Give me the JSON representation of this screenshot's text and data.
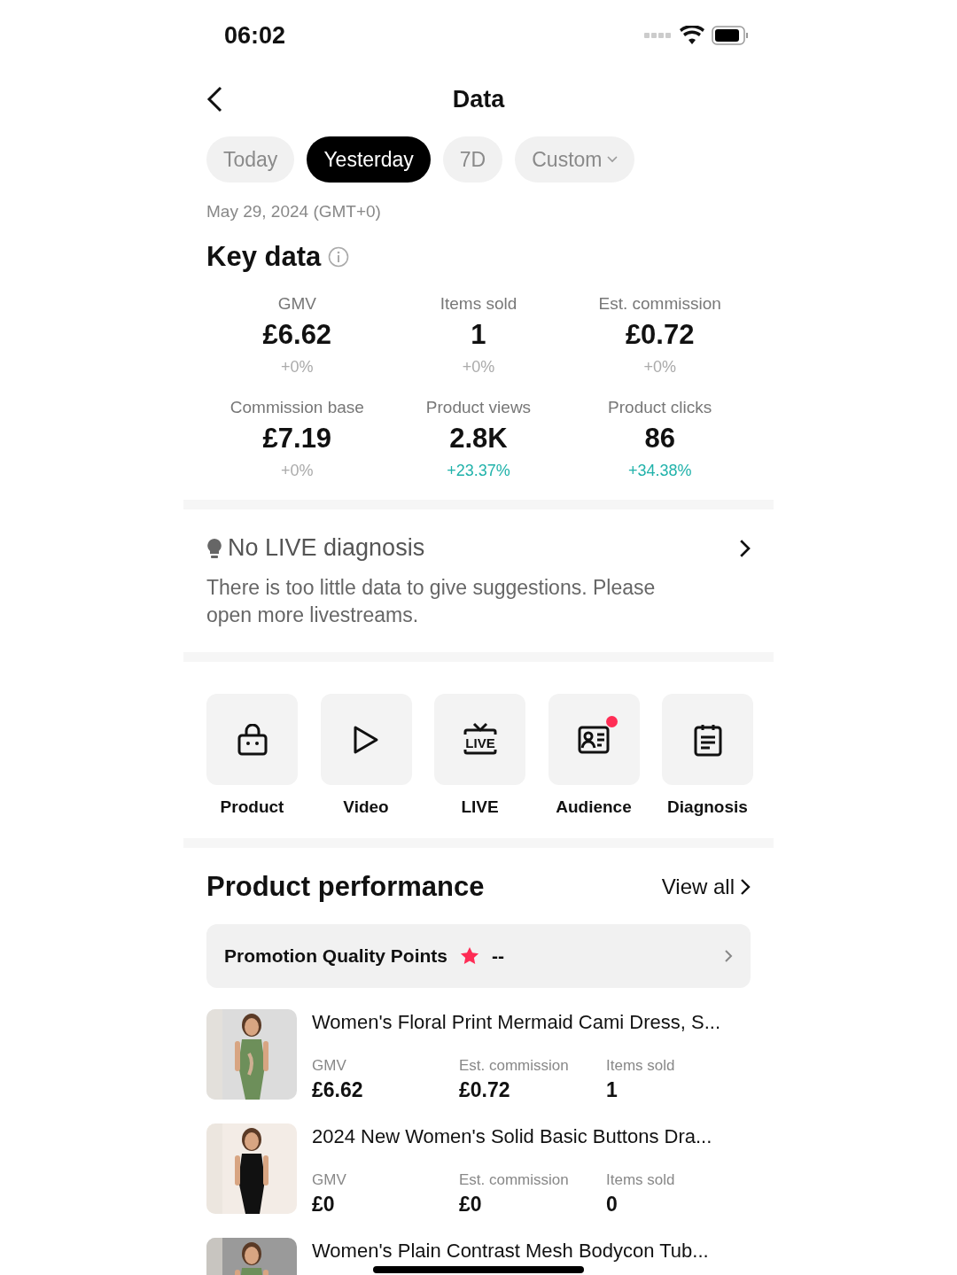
{
  "status_bar": {
    "time": "06:02"
  },
  "header": {
    "title": "Data"
  },
  "tabs": [
    {
      "label": "Today",
      "selected": false,
      "dropdown": false
    },
    {
      "label": "Yesterday",
      "selected": true,
      "dropdown": false
    },
    {
      "label": "7D",
      "selected": false,
      "dropdown": false
    },
    {
      "label": "Custom",
      "selected": false,
      "dropdown": true
    }
  ],
  "date": "May 29, 2024 (GMT+0)",
  "key_data": {
    "title": "Key data",
    "metrics": [
      {
        "label": "GMV",
        "value": "£6.62",
        "change": "+0%",
        "color": "#aaaaaa"
      },
      {
        "label": "Items sold",
        "value": "1",
        "change": "+0%",
        "color": "#aaaaaa"
      },
      {
        "label": "Est. commission",
        "value": "£0.72",
        "change": "+0%",
        "color": "#aaaaaa"
      },
      {
        "label": "Commission base",
        "value": "£7.19",
        "change": "+0%",
        "color": "#aaaaaa"
      },
      {
        "label": "Product views",
        "value": "2.8K",
        "change": "+23.37%",
        "color": "#20b2aa"
      },
      {
        "label": "Product clicks",
        "value": "86",
        "change": "+34.38%",
        "color": "#20b2aa"
      }
    ]
  },
  "diagnosis": {
    "title": "No LIVE diagnosis",
    "text": "There is too little data to give suggestions. Please open more livestreams."
  },
  "shortcuts": [
    {
      "label": "Product",
      "badge": false
    },
    {
      "label": "Video",
      "badge": false
    },
    {
      "label": "LIVE",
      "badge": false,
      "icon_text": "LIVE"
    },
    {
      "label": "Audience",
      "badge": true
    },
    {
      "label": "Diagnosis",
      "badge": false
    }
  ],
  "product_performance": {
    "title": "Product performance",
    "view_all": "View all",
    "promotion": {
      "label": "Promotion Quality Points",
      "value": "--"
    },
    "products": [
      {
        "name": "Women's Floral Print Mermaid Cami Dress, S...",
        "kind": "picture",
        "stats": [
          {
            "label": "GMV",
            "value": "£6.62"
          },
          {
            "label": "Est. commission",
            "value": "£0.72"
          },
          {
            "label": "Items sold",
            "value": "1"
          }
        ]
      },
      {
        "name": "2024 New Women's Solid Basic Buttons Dra...",
        "kind": "picture",
        "stats": [
          {
            "label": "GMV",
            "value": "£0"
          },
          {
            "label": "Est. commission",
            "value": "£0"
          },
          {
            "label": "Items sold",
            "value": "0"
          }
        ]
      },
      {
        "name": "Women's Plain Contrast Mesh Bodycon Tub...",
        "kind": "picture"
      }
    ]
  }
}
